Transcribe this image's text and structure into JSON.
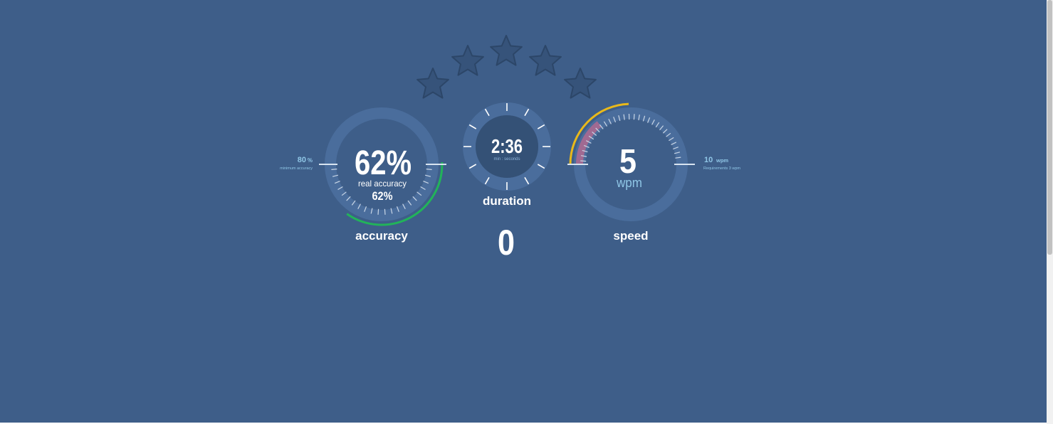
{
  "colors": {
    "background": "#3e5e89",
    "ring": "#4a6d9c",
    "ring_inner": "#345176",
    "accent_green": "#22b35a",
    "accent_yellow": "#e9b91a",
    "accent_pink": "#a06a92",
    "label_blue": "#8fc6e6",
    "white": "#ffffff"
  },
  "rating": {
    "stars_total": 5,
    "stars_filled": 0,
    "star_icon": "star-icon"
  },
  "accuracy": {
    "value": "62%",
    "sub_label": "real accuracy",
    "sub_value": "62%",
    "title": "accuracy",
    "min_value": "80",
    "min_unit": "%",
    "min_label": "minimum accuracy",
    "fraction": 0.62
  },
  "duration": {
    "value": "2:36",
    "unit": "min : seconds",
    "title": "duration"
  },
  "counter": {
    "value": "0"
  },
  "speed": {
    "value": "5",
    "unit": "wpm",
    "title": "speed",
    "req_value": "10",
    "req_unit": "wpm",
    "req_label": "Requirements 3 wpm"
  }
}
